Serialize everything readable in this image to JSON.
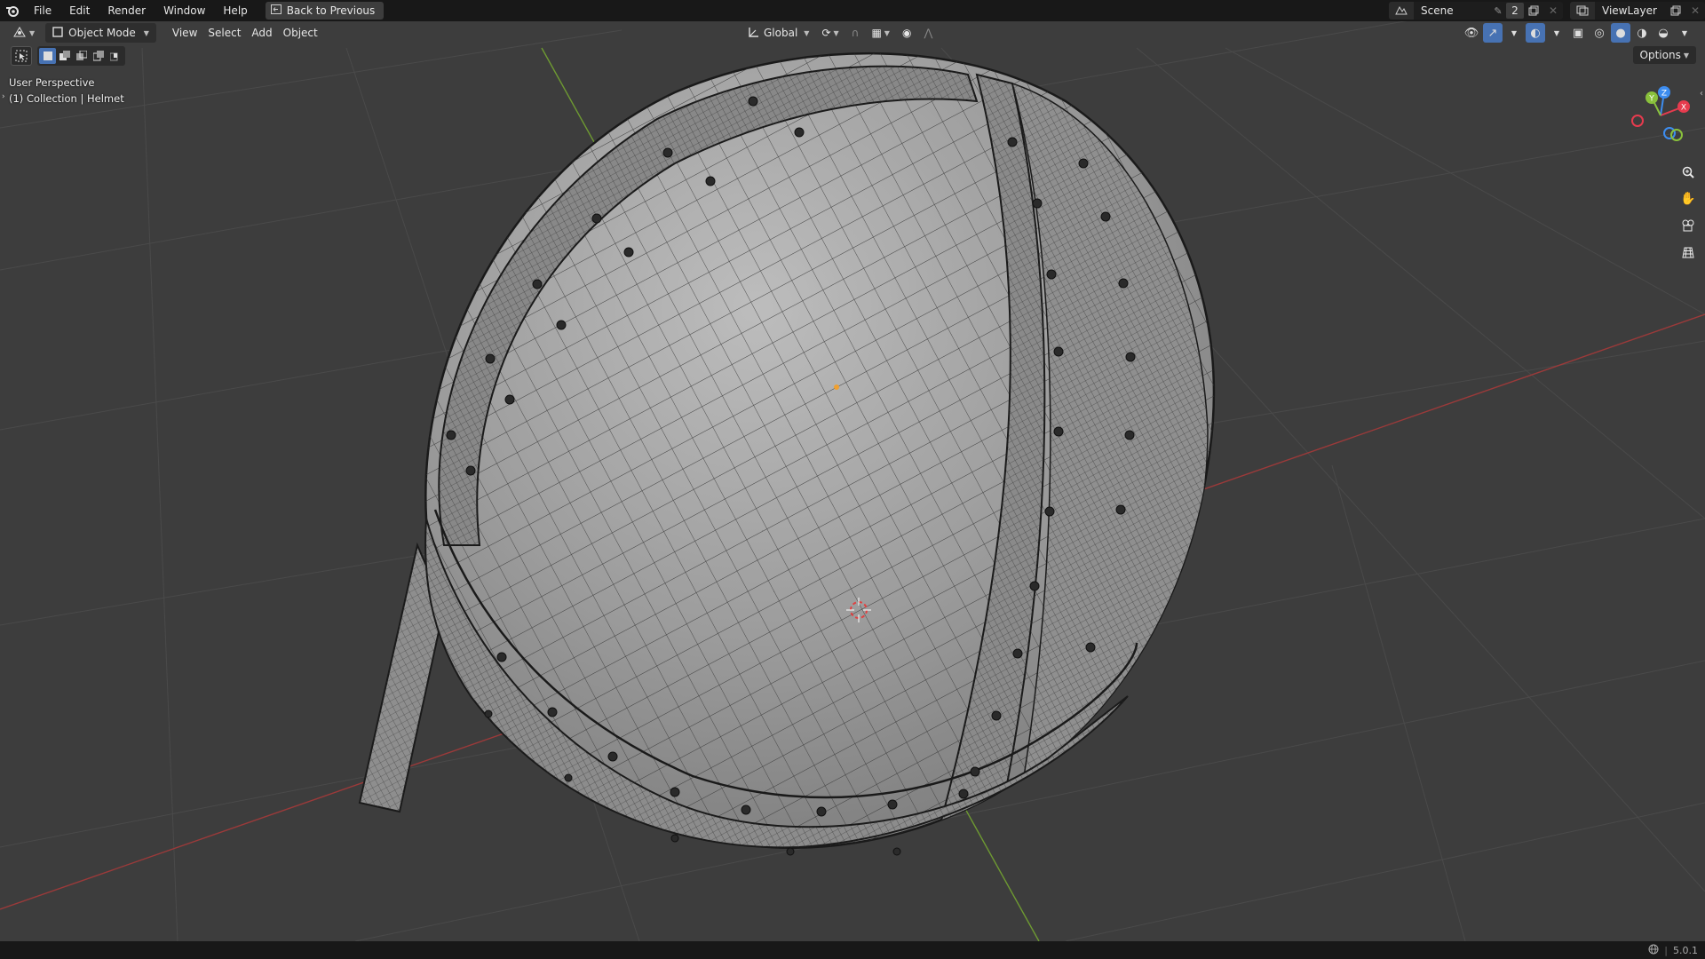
{
  "app": {
    "menu": [
      "File",
      "Edit",
      "Render",
      "Window",
      "Help"
    ],
    "back_button": "Back to Previous",
    "scene_name": "Scene",
    "scene_count": "2",
    "view_layer": "ViewLayer"
  },
  "viewport_header": {
    "mode": "Object Mode",
    "menus": [
      "View",
      "Select",
      "Add",
      "Object"
    ],
    "transform_orientation": "Global",
    "options_label": "Options"
  },
  "overlay": {
    "perspective": "User Perspective",
    "collection": "(1) Collection | Helmet"
  },
  "gizmo": {
    "x_label": "X",
    "y_label": "Y",
    "z_label": "Z",
    "x_color": "#e63b4e",
    "y_color": "#8ac13c",
    "z_color": "#3d8df0"
  },
  "statusbar": {
    "version": "5.0.1"
  },
  "colors": {
    "viewport_bg": "#3d3d3d",
    "header_bg": "#181818",
    "x_axis": "#9b3a3a",
    "y_axis": "#6e9a32",
    "selection_blue": "#4772b3"
  }
}
